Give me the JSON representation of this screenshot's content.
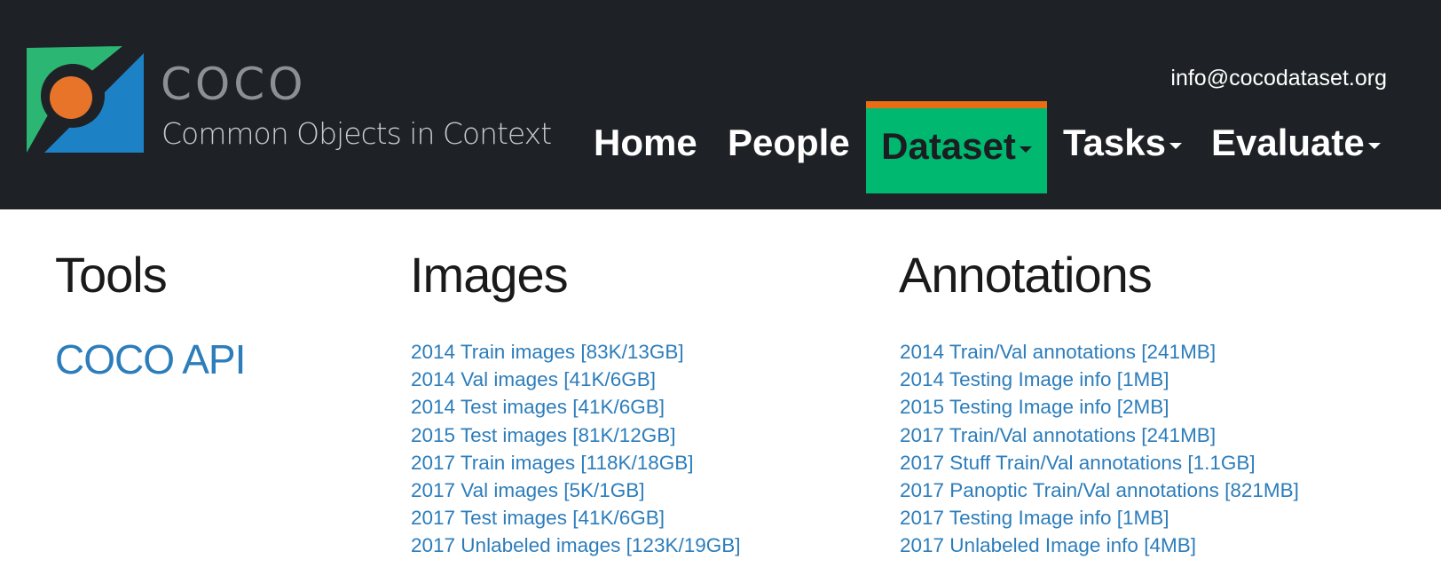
{
  "brand": {
    "title": "COCO",
    "subtitle": "Common Objects in Context",
    "colors": {
      "green": "#2cb673",
      "blue": "#1c82c5",
      "orange": "#e8742a",
      "dark": "#1e2126"
    }
  },
  "header": {
    "email": "info@cocodataset.org"
  },
  "nav": {
    "home": "Home",
    "people": "People",
    "dataset": "Dataset",
    "tasks": "Tasks",
    "evaluate": "Evaluate",
    "active": "Dataset",
    "active_color": "#00b870",
    "active_accent": "#e86d15"
  },
  "tools": {
    "heading": "Tools",
    "links": [
      "COCO API"
    ]
  },
  "images": {
    "heading": "Images",
    "links": [
      "2014 Train images [83K/13GB]",
      "2014 Val images [41K/6GB]",
      "2014 Test images [41K/6GB]",
      "2015 Test images [81K/12GB]",
      "2017 Train images [118K/18GB]",
      "2017 Val images [5K/1GB]",
      "2017 Test images [41K/6GB]",
      "2017 Unlabeled images [123K/19GB]"
    ]
  },
  "annotations": {
    "heading": "Annotations",
    "links": [
      "2014 Train/Val annotations [241MB]",
      "2014 Testing Image info [1MB]",
      "2015 Testing Image info [2MB]",
      "2017 Train/Val annotations [241MB]",
      "2017 Stuff Train/Val annotations [1.1GB]",
      "2017 Panoptic Train/Val annotations [821MB]",
      "2017 Testing Image info [1MB]",
      "2017 Unlabeled Image info [4MB]"
    ]
  },
  "link_color": "#2c7dbb"
}
